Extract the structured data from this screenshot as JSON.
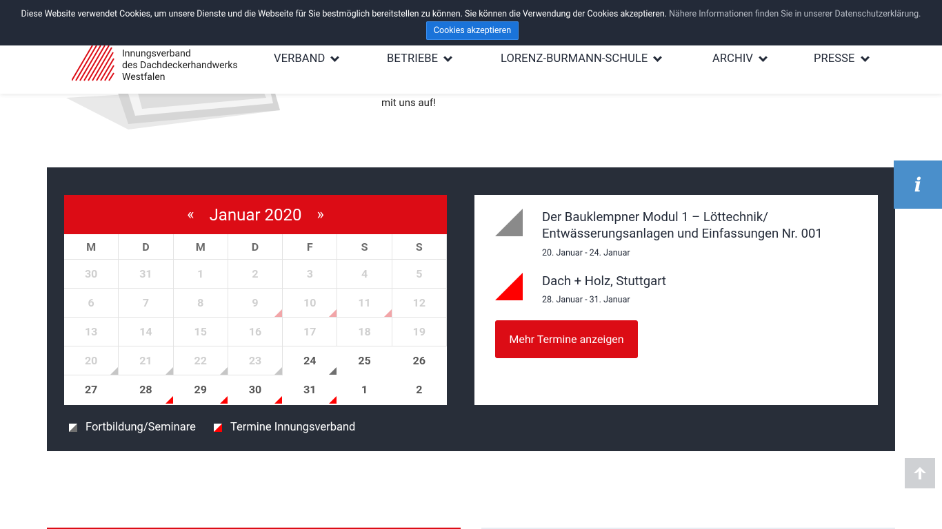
{
  "cookie": {
    "text": "Diese Website verwendet Cookies, um unsere Dienste und die Webseite für Sie bestmöglich bereitstellen zu können. Sie können die Verwendung der Cookies akzeptieren.",
    "more_link": "Nähere Informationen finden Sie in unserer Datenschutzerklärung.",
    "accept_label": "Cookies akzeptieren"
  },
  "logo": {
    "line1": "Innungsverband",
    "line2": "des Dachdeckerhandwerks",
    "line3": "Westfalen",
    "stripe_color": "#dc0c15"
  },
  "nav": {
    "items": [
      {
        "label": "VERBAND"
      },
      {
        "label": "BETRIEBE"
      },
      {
        "label": "LORENZ-BURMANN-SCHULE"
      },
      {
        "label": "ARCHIV"
      },
      {
        "label": "PRESSE"
      }
    ]
  },
  "intro": {
    "partial_text": "mit uns auf!"
  },
  "calendar": {
    "prev": "«",
    "next": "»",
    "month_label": "Januar 2020",
    "weekdays": [
      "M",
      "D",
      "M",
      "D",
      "F",
      "S",
      "S"
    ],
    "weeks": [
      [
        {
          "d": "30"
        },
        {
          "d": "31"
        },
        {
          "d": "1"
        },
        {
          "d": "2"
        },
        {
          "d": "3"
        },
        {
          "d": "4"
        },
        {
          "d": "5"
        }
      ],
      [
        {
          "d": "6"
        },
        {
          "d": "7"
        },
        {
          "d": "8"
        },
        {
          "d": "9",
          "mark": "red-light"
        },
        {
          "d": "10",
          "mark": "red-light"
        },
        {
          "d": "11",
          "mark": "red-light"
        },
        {
          "d": "12"
        }
      ],
      [
        {
          "d": "13"
        },
        {
          "d": "14"
        },
        {
          "d": "15"
        },
        {
          "d": "16"
        },
        {
          "d": "17"
        },
        {
          "d": "18"
        },
        {
          "d": "19"
        }
      ],
      [
        {
          "d": "20",
          "mark": "gray-light"
        },
        {
          "d": "21",
          "mark": "gray-light"
        },
        {
          "d": "22",
          "mark": "gray-light"
        },
        {
          "d": "23",
          "mark": "gray-light"
        },
        {
          "d": "24",
          "active": true,
          "mark": "gray-dark"
        },
        {
          "d": "25",
          "active": true
        },
        {
          "d": "26",
          "active": true
        }
      ],
      [
        {
          "d": "27",
          "active": true
        },
        {
          "d": "28",
          "active": true,
          "mark": "red"
        },
        {
          "d": "29",
          "active": true,
          "mark": "red"
        },
        {
          "d": "30",
          "active": true,
          "mark": "red"
        },
        {
          "d": "31",
          "active": true,
          "mark": "red"
        },
        {
          "d": "1",
          "active": true
        },
        {
          "d": "2",
          "active": true
        }
      ]
    ]
  },
  "legend": {
    "items": [
      {
        "label": "Fortbildung/Seminare",
        "color": "#6f6f6f"
      },
      {
        "label": "Termine Innungsverband",
        "color": "#ff0000"
      }
    ]
  },
  "events": {
    "items": [
      {
        "title": "Der Bauklempner Modul 1 – Löttechnik/ Entwässerungsanlagen und Einfassungen Nr. 001",
        "date": "20. Januar - 24. Januar",
        "color": "#8a8a8a"
      },
      {
        "title": "Dach + Holz, Stuttgart",
        "date": "28. Januar - 31. Januar",
        "color": "#ff0000"
      }
    ],
    "more_label": "Mehr Termine anzeigen"
  },
  "side": {
    "info_label": "i"
  },
  "colors": {
    "brand_red": "#dc0c15",
    "dark_bg": "#282e39",
    "cookie_bg": "#232a38",
    "info_blue": "#4a8fcb"
  }
}
